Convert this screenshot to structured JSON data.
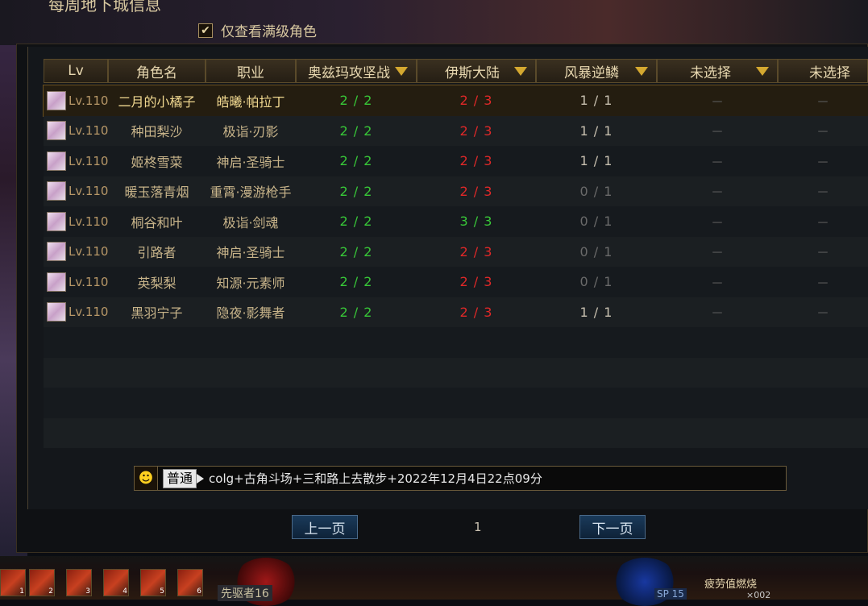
{
  "header": {
    "title": "每周地下城信息",
    "filter_label": "仅查看满级角色",
    "filter_checked_mark": "✔"
  },
  "table": {
    "columns": [
      "Lv",
      "角色名",
      "职业",
      "奥兹玛攻坚战",
      "伊斯大陆",
      "风暴逆鳞",
      "未选择",
      "未选择"
    ],
    "rows": [
      {
        "lv": "Lv.110",
        "name": "二月的小橘子",
        "job": "皓曦·帕拉丁",
        "a": "2 / 2",
        "b": "2 / 3",
        "c": "1 / 1",
        "d": "－",
        "e": "－"
      },
      {
        "lv": "Lv.110",
        "name": "种田梨沙",
        "job": "极诣·刃影",
        "a": "2 / 2",
        "b": "2 / 3",
        "c": "1 / 1",
        "d": "－",
        "e": "－"
      },
      {
        "lv": "Lv.110",
        "name": "姬柊雪菜",
        "job": "神启·圣骑士",
        "a": "2 / 2",
        "b": "2 / 3",
        "c": "1 / 1",
        "d": "－",
        "e": "－"
      },
      {
        "lv": "Lv.110",
        "name": "暖玉落青烟",
        "job": "重霄·漫游枪手",
        "a": "2 / 2",
        "b": "2 / 3",
        "c": "0 / 1",
        "d": "－",
        "e": "－"
      },
      {
        "lv": "Lv.110",
        "name": "桐谷和叶",
        "job": "极诣·剑魂",
        "a": "2 / 2",
        "b": "3 / 3",
        "c": "0 / 1",
        "d": "－",
        "e": "－"
      },
      {
        "lv": "Lv.110",
        "name": "引路者",
        "job": "神启·圣骑士",
        "a": "2 / 2",
        "b": "2 / 3",
        "c": "0 / 1",
        "d": "－",
        "e": "－"
      },
      {
        "lv": "Lv.110",
        "name": "英梨梨",
        "job": "知源·元素师",
        "a": "2 / 2",
        "b": "2 / 3",
        "c": "0 / 1",
        "d": "－",
        "e": "－"
      },
      {
        "lv": "Lv.110",
        "name": "黑羽宁子",
        "job": "隐夜·影舞者",
        "a": "2 / 2",
        "b": "2 / 3",
        "c": "1 / 1",
        "d": "－",
        "e": "－"
      }
    ]
  },
  "chat": {
    "emoji": "☻",
    "channel": "普通",
    "message": "colg+古角斗场+三和路上去散步+2022年12月4日22点09分"
  },
  "pagination": {
    "prev_label": "上一页",
    "next_label": "下一页",
    "current_page": "1"
  },
  "hud": {
    "hotkeys": [
      "1",
      "2",
      "3",
      "4",
      "5",
      "6"
    ],
    "vanguard_label": "先驱者16",
    "sp_label": "SP 15",
    "fatigue_label": "疲劳值燃烧",
    "fatigue_count": "×002"
  },
  "colors": {
    "green": "#38c838",
    "red": "#e02828",
    "gold": "#d4a830"
  }
}
